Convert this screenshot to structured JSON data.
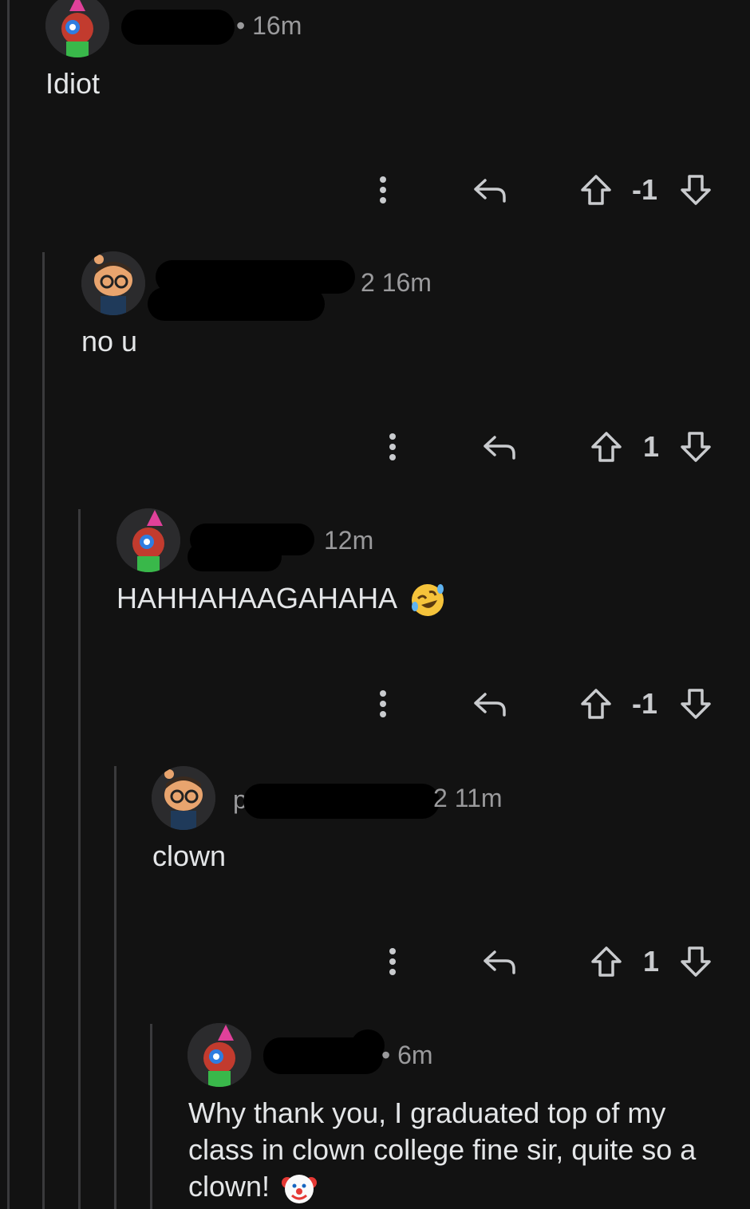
{
  "comments": [
    {
      "time": "• 16m",
      "body": "Idiot",
      "score": "-1",
      "avatar": "party-zombie-avatar-icon"
    },
    {
      "time": "2 16m",
      "body": "no u",
      "score": "1",
      "avatar": "glasses-snoo-avatar-icon"
    },
    {
      "time": "12m",
      "body": "HAHHAHAAGAHAHA",
      "emoji": "rolling-laughing-emoji-icon",
      "score": "-1",
      "avatar": "party-zombie-avatar-icon"
    },
    {
      "time": "2 11m",
      "name_fragment": "p",
      "body": "clown",
      "score": "1",
      "avatar": "glasses-snoo-avatar-icon"
    },
    {
      "time": "• 6m",
      "body": "Why thank you, I graduated top of my class in clown college fine sir, quite so a clown!",
      "emoji": "clown-emoji-icon",
      "avatar": "party-zombie-avatar-icon"
    }
  ],
  "colors": {
    "background": "#121212",
    "text": "#e4e6e8",
    "meta": "#9a9a9c",
    "thread_line": "#3a3a3c"
  }
}
